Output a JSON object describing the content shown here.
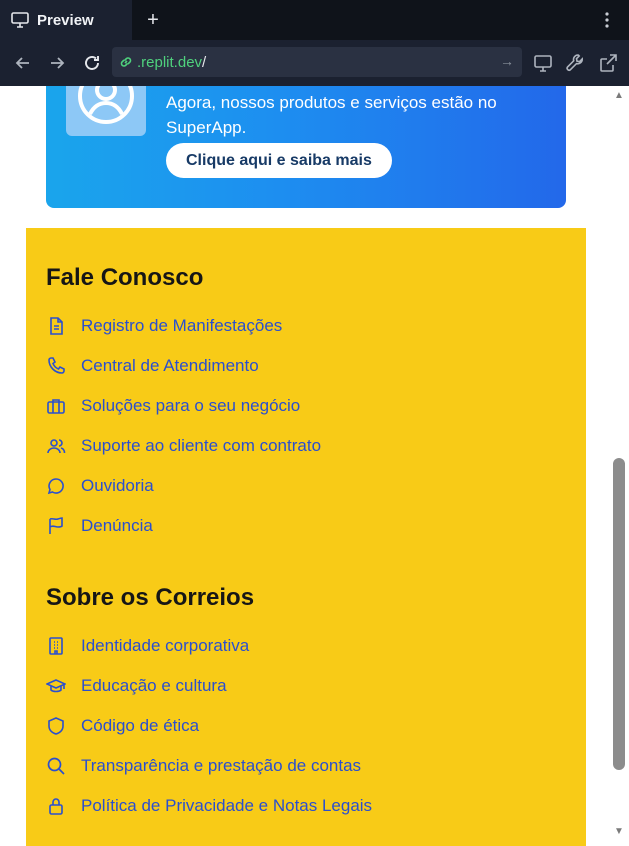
{
  "browser": {
    "tab_title": "Preview",
    "new_tab_label": "+",
    "url_host": ".replit.dev",
    "url_path": "/"
  },
  "promo": {
    "text": "Agora, nossos produtos e serviços estão no SuperApp.",
    "button_label": "Clique aqui e saiba mais"
  },
  "fale_conosco": {
    "title": "Fale Conosco",
    "items": [
      {
        "label": "Registro de Manifestações",
        "icon": "document-icon"
      },
      {
        "label": "Central de Atendimento",
        "icon": "phone-icon"
      },
      {
        "label": "Soluções para o seu negócio",
        "icon": "briefcase-icon"
      },
      {
        "label": "Suporte ao cliente com contrato",
        "icon": "users-icon"
      },
      {
        "label": "Ouvidoria",
        "icon": "chat-bubble-icon"
      },
      {
        "label": "Denúncia",
        "icon": "flag-icon"
      }
    ]
  },
  "sobre": {
    "title": "Sobre os Correios",
    "items": [
      {
        "label": "Identidade corporativa",
        "icon": "building-icon"
      },
      {
        "label": "Educação e cultura",
        "icon": "graduation-cap-icon"
      },
      {
        "label": "Código de ética",
        "icon": "shield-icon"
      },
      {
        "label": "Transparência e prestação de contas",
        "icon": "search-icon"
      },
      {
        "label": "Política de Privacidade e Notas Legais",
        "icon": "lock-icon"
      }
    ]
  },
  "colors": {
    "footer_bg": "#f8cb17",
    "link": "#2a4fcf",
    "promo_start": "#1aa5ec",
    "promo_end": "#2368ea"
  }
}
